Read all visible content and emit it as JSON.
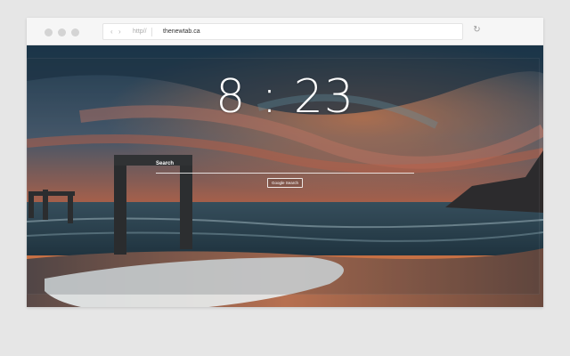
{
  "browser": {
    "url_protocol": "http//",
    "url_host": "thenewtab.ca",
    "back_icon": "chevron-left-icon",
    "forward_icon": "chevron-right-icon",
    "reload_icon": "reload-icon"
  },
  "page": {
    "clock_time": "8 : 23",
    "search_label": "Search",
    "search_placeholder": "",
    "search_button_label": "Google Search"
  },
  "colors": {
    "window_dots": "#d4d4d4",
    "sky_top": "#26475b",
    "sunset_orange": "#e8743e",
    "sea": "#2c4c5c",
    "sand": "#a86a48"
  }
}
